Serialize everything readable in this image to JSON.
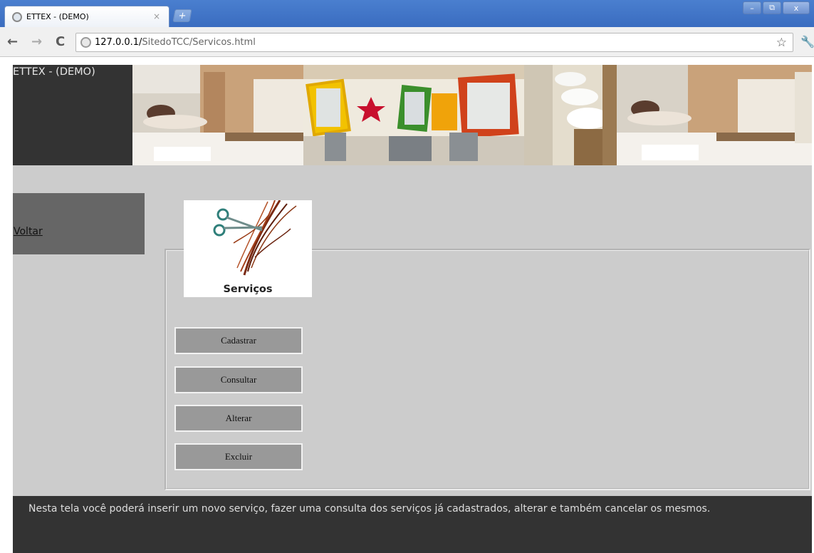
{
  "browser": {
    "tab_title": "ETTEX - (DEMO)",
    "tab_close": "×",
    "new_tab": "+",
    "window_buttons": {
      "minimize": "–",
      "maximize": "⧉",
      "close": "x"
    },
    "url_host": "127.0.0.1/",
    "url_path": "SitedoTCC/Servicos.html",
    "back_icon": "←",
    "forward_icon": "→",
    "reload_icon": "C",
    "star_icon": "☆",
    "wrench_icon": "🔧"
  },
  "header": {
    "title": "ETTEX - (DEMO)"
  },
  "sidebar": {
    "back_link": "Voltar"
  },
  "services": {
    "logo_caption": "Serviços",
    "buttons": [
      "Cadastrar",
      "Consultar",
      "Alterar",
      "Excluir"
    ]
  },
  "footer": {
    "text": "Nesta tela você poderá inserir um novo serviço, fazer uma consulta dos serviços já cadastrados, alterar e também cancelar os mesmos."
  },
  "colors": {
    "page_bg": "#cccccc",
    "dark_panel": "#333333",
    "sidebar_block": "#666666",
    "button_bg": "#999999"
  }
}
